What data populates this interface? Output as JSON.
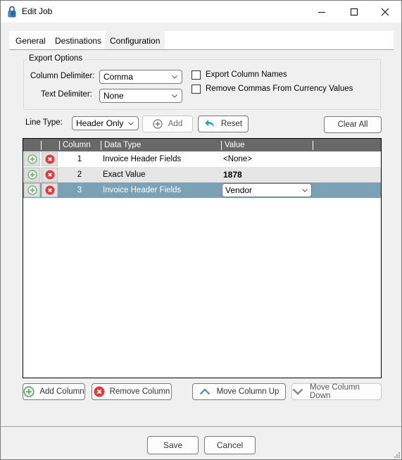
{
  "window": {
    "title": "Edit Job",
    "icon": "lock-icon",
    "controls": {
      "minimize": "minimize-icon",
      "maximize": "maximize-icon",
      "close": "close-icon"
    }
  },
  "tabs": [
    {
      "label": "General",
      "active": false
    },
    {
      "label": "Destinations",
      "active": false
    },
    {
      "label": "Configuration",
      "active": true
    }
  ],
  "export_options": {
    "title": "Export Options",
    "column_delimiter": {
      "label": "Column Delimiter:",
      "value": "Comma"
    },
    "text_delimiter": {
      "label": "Text Delimiter:",
      "value": "None"
    },
    "export_column_names": {
      "label": "Export Column Names",
      "checked": false
    },
    "remove_commas": {
      "label": "Remove Commas From Currency Values",
      "checked": false
    }
  },
  "line_type": {
    "label": "Line Type:",
    "value": "Header Only",
    "add_label": "Add",
    "reset_label": "Reset",
    "clear_all_label": "Clear All"
  },
  "grid": {
    "columns": [
      "",
      "",
      "Column",
      "Data Type",
      "Value",
      ""
    ],
    "rows": [
      {
        "column": "1",
        "data_type": "Invoice Header Fields",
        "value": "<None>",
        "editor": "text"
      },
      {
        "column": "2",
        "data_type": "Exact Value",
        "value": "1878",
        "editor": "bold"
      },
      {
        "column": "3",
        "data_type": "Invoice Header Fields",
        "value": "Vendor",
        "editor": "combo",
        "selected": true
      }
    ],
    "colors": {
      "header_bg": "#696969",
      "selected_row_bg": "#7aa1b5",
      "alt_row_bg": "#e6e6e6"
    }
  },
  "column_actions": {
    "add_column": "Add Column",
    "remove_column": "Remove Column",
    "move_up": "Move Column Up",
    "move_down": "Move Column Down"
  },
  "footer": {
    "save_label": "Save",
    "cancel_label": "Cancel"
  }
}
